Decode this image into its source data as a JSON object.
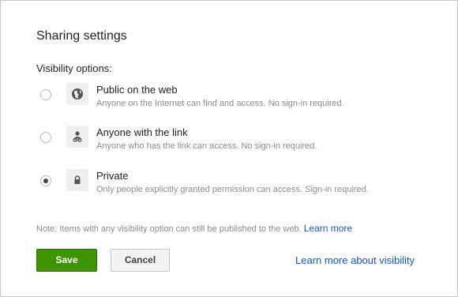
{
  "dialog": {
    "title": "Sharing settings",
    "section_label": "Visibility options:",
    "options": [
      {
        "title": "Public on the web",
        "description": "Anyone on the Internet can find and access. No sign-in required.",
        "icon": "globe-icon",
        "selected": false
      },
      {
        "title": "Anyone with the link",
        "description": "Anyone who has the link can access. No sign-in required.",
        "icon": "link-user-icon",
        "selected": false
      },
      {
        "title": "Private",
        "description": "Only people explicitly granted permission can access. Sign-in required.",
        "icon": "lock-icon",
        "selected": true
      }
    ],
    "note": "Note: Items with any visibility option can still be published to the web.",
    "note_link": "Learn more",
    "save_label": "Save",
    "cancel_label": "Cancel",
    "learn_more_visibility": "Learn more about visibility"
  },
  "colors": {
    "save_button": "#3d9400",
    "link": "#1155cc",
    "secondary_text": "#8a8a8a"
  }
}
